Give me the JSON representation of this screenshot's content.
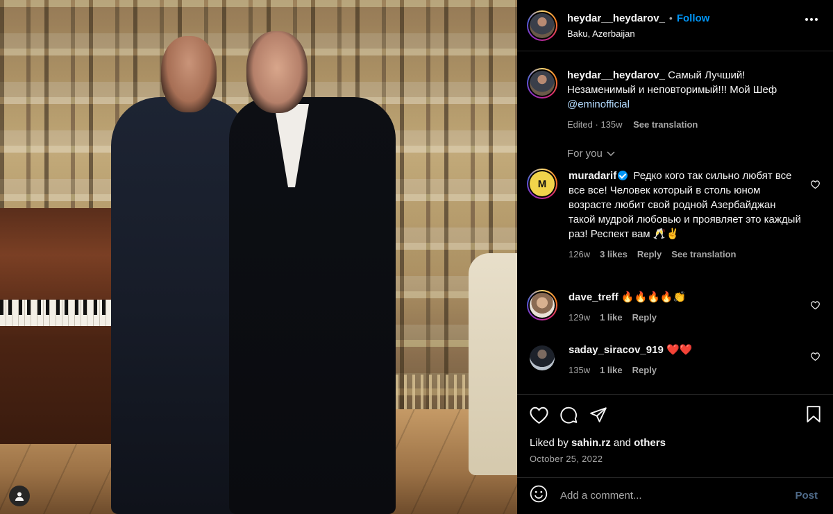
{
  "post": {
    "author": "heydar__heydarov_",
    "follow_label": "Follow",
    "separator": "•",
    "location": "Baku, Azerbaijan"
  },
  "caption": {
    "username": "heydar__heydarov_",
    "text": "Самый Лучший! Незаменимый и неповторимый!!! Мой Шеф",
    "mention": "@eminofficial",
    "edited": "Edited",
    "age": "135w",
    "see_translation": "See translation"
  },
  "for_you": {
    "label": "For you"
  },
  "comments": [
    {
      "username": "muradarif",
      "verified": true,
      "text": "Редко кого так сильно любят все все все! Человек который в столь юном возрасте любит свой родной Азербайджан такой мудрой любовью и проявляет это каждый раз! Респект вам 🥂✌️",
      "age": "126w",
      "likes": "3 likes",
      "reply": "Reply",
      "see_translation": "See translation"
    },
    {
      "username": "dave_treff",
      "text": "🔥🔥🔥🔥👏",
      "age": "129w",
      "likes": "1 like",
      "reply": "Reply"
    },
    {
      "username": "saday_siracov_919",
      "text": "❤️❤️",
      "age": "135w",
      "likes": "1 like",
      "reply": "Reply"
    }
  ],
  "liked_by": {
    "prefix": "Liked by",
    "user": "sahin.rz",
    "conj": "and",
    "others": "others"
  },
  "date": "October 25, 2022",
  "add_comment": {
    "placeholder": "Add a comment...",
    "post_label": "Post"
  },
  "colors": {
    "accent": "#0095f6",
    "text": "#f5f5f5",
    "muted": "#a8a8a8",
    "background": "#000000"
  },
  "icons": [
    "user-tag-icon",
    "more-options-icon",
    "chevron-down-icon",
    "like-icon",
    "comment-icon",
    "share-icon",
    "save-icon",
    "emoji-icon",
    "verified-badge-icon"
  ]
}
